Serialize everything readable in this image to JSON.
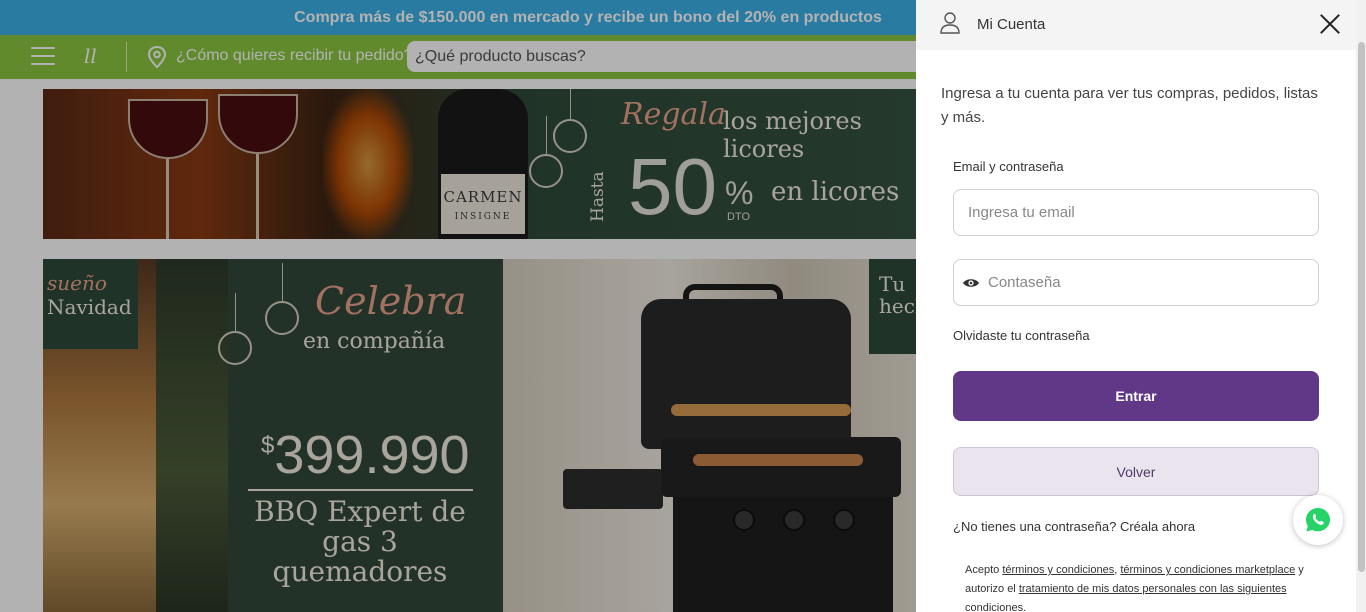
{
  "promo": {
    "text": "Compra más de $150.000 en mercado y recibe un bono del 20% en productos"
  },
  "nav": {
    "logo": "ll",
    "delivery_prompt": "¿Cómo quieres recibir tu pedido?",
    "search_placeholder": "¿Qué producto buscas?"
  },
  "banner_licores": {
    "label_brand": "CARMEN",
    "label_sub": "INSIGNE",
    "regala": "Regala",
    "mejores": "los mejores licores",
    "hasta": "Hasta",
    "percent": "50",
    "percent_symbol": "%",
    "dto": "DTO",
    "en_licores": "en licores"
  },
  "banner_bbq": {
    "left_tag_line1": "sueño",
    "left_tag_line2": "Navidad",
    "celebra": "Celebra",
    "en_compania": "en compañía",
    "price_currency": "$",
    "price_amount": "399.990",
    "product_line1": "BBQ Expert de",
    "product_line2": "gas 3 quemadores",
    "right_tag_line1": "Tu",
    "right_tag_line2": "hech"
  },
  "account_drawer": {
    "title": "Mi Cuenta",
    "intro": "Ingresa a tu cuenta para ver tus compras, pedidos, listas y más.",
    "section_label": "Email y contraseña",
    "email_placeholder": "Ingresa tu email",
    "password_placeholder": "Contaseña",
    "forgot_link": "Olvidaste tu contraseña",
    "login_button": "Entrar",
    "back_button": "Volver",
    "signup_prompt": "¿No tienes una contraseña?",
    "signup_link": "Créala ahora",
    "terms_prefix": "Acepto ",
    "terms_link1": "términos y condiciones",
    "terms_sep": ", ",
    "terms_link2": "términos y condiciones marketplace",
    "terms_mid": " y autorizo el ",
    "terms_link3": "tratamiento de mis datos personales con las siguientes condiciones",
    "terms_end": "."
  },
  "icons": {
    "menu": "hamburger-icon",
    "location": "map-pin-icon",
    "user": "user-icon",
    "close": "close-icon",
    "password_toggle": "eye-icon",
    "chat": "whatsapp-icon"
  },
  "colors": {
    "promo_bar": "#3bb0e8",
    "nav_bar": "#8cc63f",
    "primary_button": "#613787",
    "secondary_button": "#eae4ee",
    "whatsapp": "#25d366"
  }
}
